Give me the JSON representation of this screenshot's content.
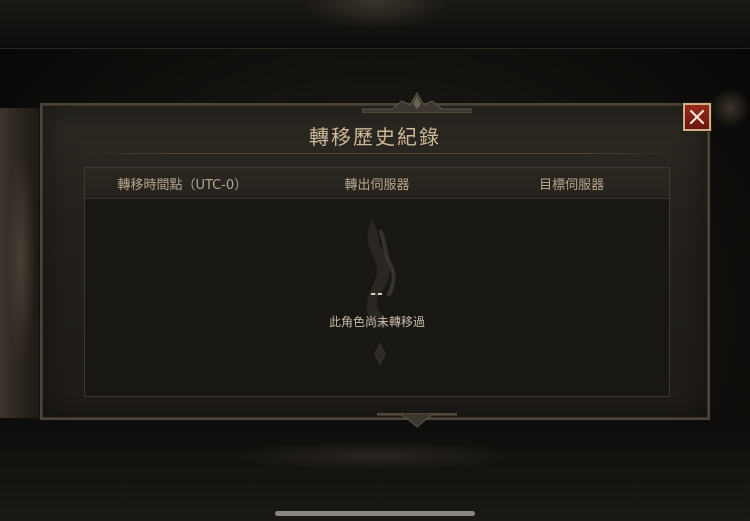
{
  "dialog": {
    "title": "轉移歷史紀錄",
    "close_icon": "close-icon"
  },
  "table": {
    "columns": [
      {
        "label": "轉移時間點（UTC-0）"
      },
      {
        "label": "轉出伺服器"
      },
      {
        "label": "目標伺服器"
      }
    ],
    "rows": []
  },
  "empty_state": {
    "dash": "--",
    "message": "此角色尚未轉移過",
    "emblem_icon": "rune-emblem-icon"
  },
  "colors": {
    "title": "#cdb897",
    "close_button": "#8a2316",
    "panel": "#25221d"
  }
}
